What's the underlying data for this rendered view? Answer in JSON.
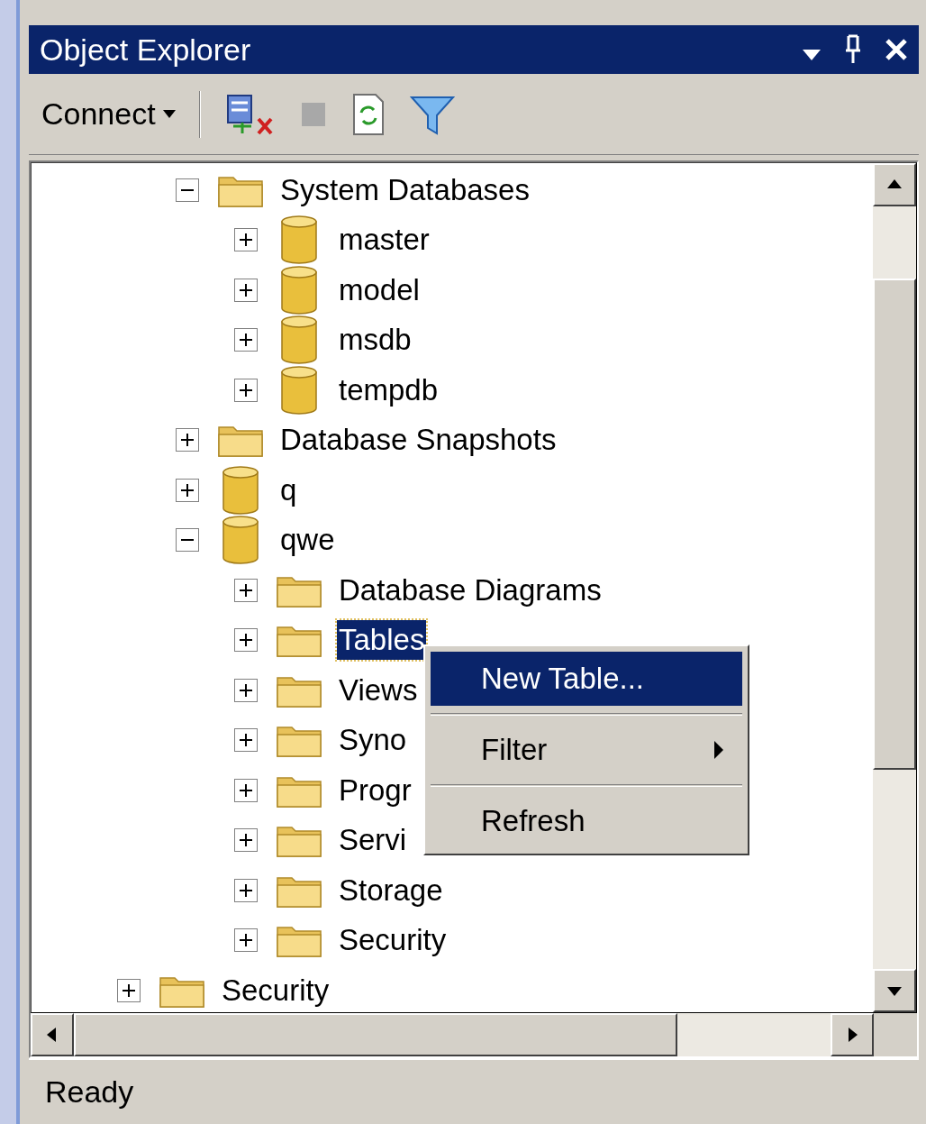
{
  "window": {
    "title": "Object Explorer"
  },
  "toolbar": {
    "connect_label": "Connect"
  },
  "tree": {
    "items": [
      {
        "children": [
          {
            "label": "System Databases",
            "kind": "folder",
            "expanded": true,
            "selected": false,
            "children": [
              {
                "label": "master",
                "kind": "database",
                "expanded": false,
                "selected": false
              },
              {
                "label": "model",
                "kind": "database",
                "expanded": false,
                "selected": false
              },
              {
                "label": "msdb",
                "kind": "database",
                "expanded": false,
                "selected": false
              },
              {
                "label": "tempdb",
                "kind": "database",
                "expanded": false,
                "selected": false
              }
            ]
          },
          {
            "label": "Database Snapshots",
            "kind": "folder",
            "expanded": false,
            "selected": false
          },
          {
            "label": "q",
            "kind": "database",
            "expanded": false,
            "selected": false
          },
          {
            "label": "qwe",
            "kind": "database",
            "expanded": true,
            "selected": false,
            "children": [
              {
                "label": "Database Diagrams",
                "kind": "folder",
                "expanded": false,
                "selected": false
              },
              {
                "label": "Tables",
                "kind": "folder",
                "expanded": false,
                "selected": true
              },
              {
                "label": "Views",
                "kind": "folder",
                "expanded": false,
                "selected": false
              },
              {
                "label": "Syno",
                "kind": "folder",
                "expanded": false,
                "selected": false
              },
              {
                "label": "Progr",
                "kind": "folder",
                "expanded": false,
                "selected": false
              },
              {
                "label": "Servi",
                "kind": "folder",
                "expanded": false,
                "selected": false
              },
              {
                "label": "Storage",
                "kind": "folder",
                "expanded": false,
                "selected": false
              },
              {
                "label": "Security",
                "kind": "folder",
                "expanded": false,
                "selected": false
              }
            ]
          }
        ]
      },
      {
        "label": "Security",
        "kind": "folder",
        "expanded": false,
        "selected": false
      }
    ]
  },
  "context_menu": {
    "items": [
      {
        "kind": "item",
        "label": "New Table...",
        "selected": true,
        "submenu": false
      },
      {
        "kind": "separator"
      },
      {
        "kind": "item",
        "label": "Filter",
        "selected": false,
        "submenu": true
      },
      {
        "kind": "separator"
      },
      {
        "kind": "item",
        "label": "Refresh",
        "selected": false,
        "submenu": false
      }
    ]
  },
  "status_bar": {
    "text": "Ready"
  }
}
